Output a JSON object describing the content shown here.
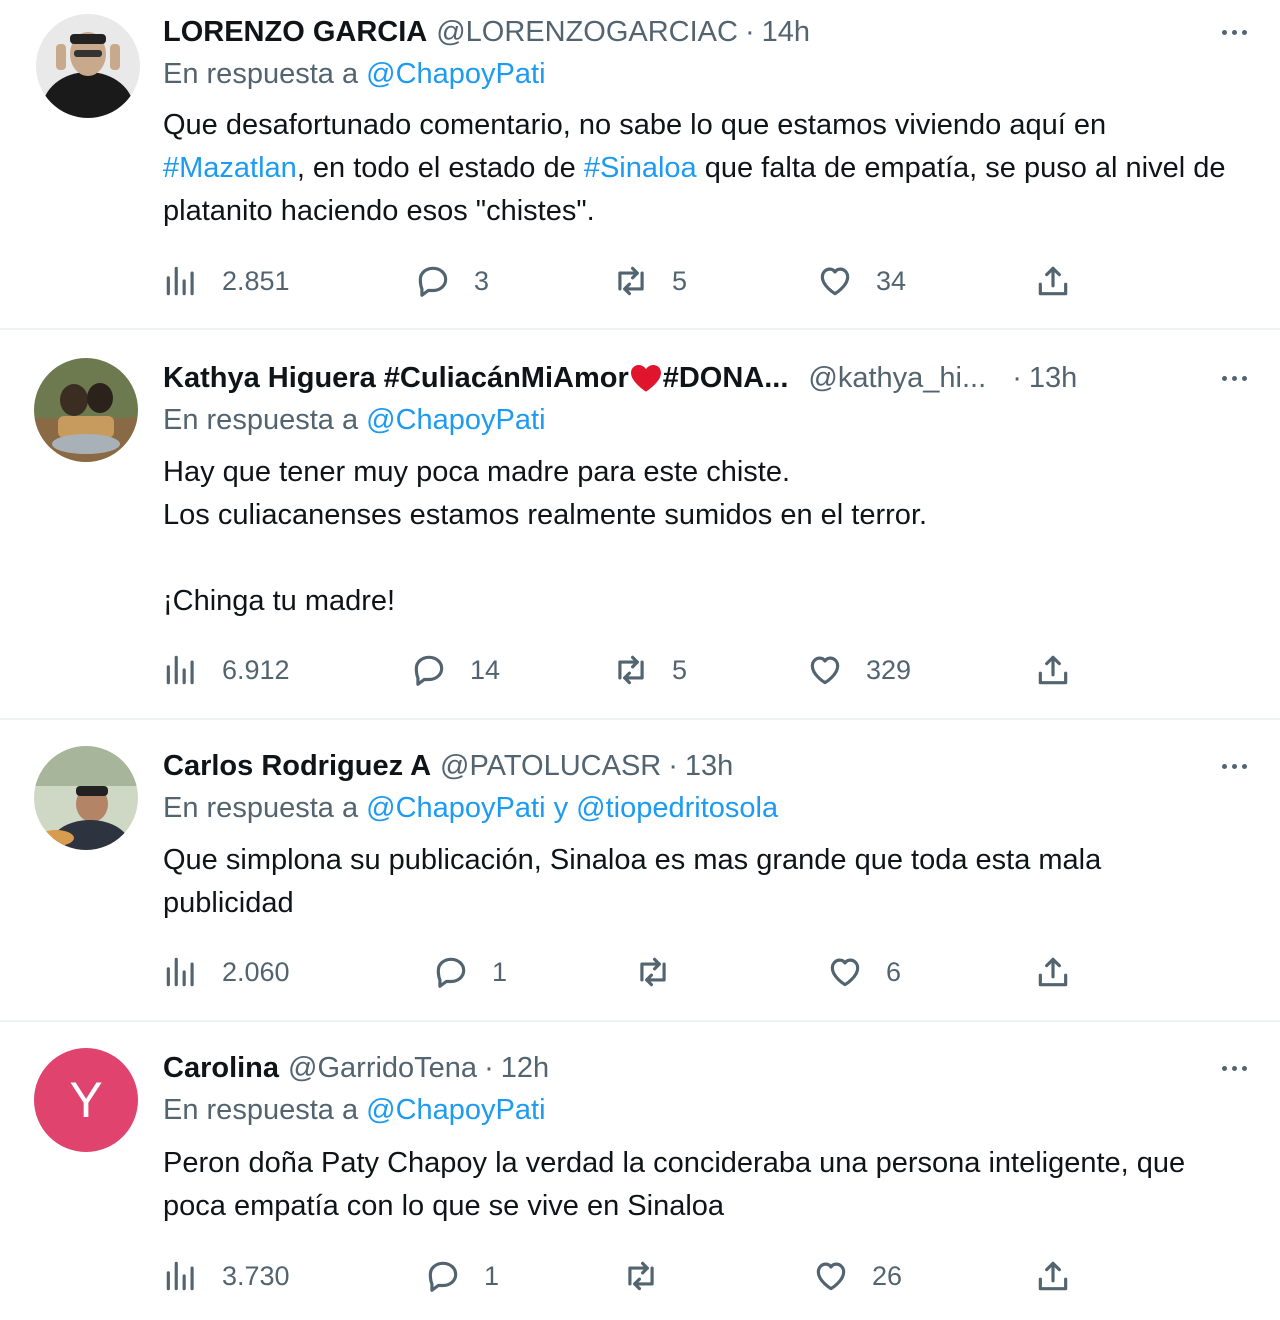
{
  "reply_prefix": "En respuesta a",
  "tweets": [
    {
      "name": "LORENZO GARCIA",
      "handle": "@LORENZOGARCIAC",
      "dot": "·",
      "time": "14h",
      "reply_to": "@ChapoyPati",
      "body_segments": [
        {
          "text": "Que desafortunado comentario, no sabe lo que estamos viviendo aquí en ",
          "type": "text"
        },
        {
          "text": "#Mazatlan",
          "type": "hashtag"
        },
        {
          "text": ", en todo el estado de ",
          "type": "text"
        },
        {
          "text": "#Sinaloa",
          "type": "hashtag"
        },
        {
          "text": " que falta de empatía, se puso al nivel de platanito haciendo esos \"chistes\".",
          "type": "text"
        }
      ],
      "views": "2.851",
      "replies": "3",
      "retweets": "5",
      "likes": "34"
    },
    {
      "name": "Kathya Higuera #CuliacánMiAmor",
      "name_suffix": "#DONA...",
      "name_emoji": "red-heart",
      "handle": "@kathya_hi...",
      "dot": "·",
      "time": "13h",
      "reply_to": "@ChapoyPati",
      "body_lines": [
        "Hay que tener muy poca madre para este chiste.",
        "Los culiacanenses estamos realmente sumidos en el terror.",
        "",
        "¡Chinga tu madre!"
      ],
      "views": "6.912",
      "replies": "14",
      "retweets": "5",
      "likes": "329"
    },
    {
      "name": "Carlos Rodriguez A",
      "handle": "@PATOLUCASR",
      "dot": "·",
      "time": "13h",
      "reply_to": "@ChapoyPati",
      "reply_joiner": "y",
      "reply_to_2": "@tiopedritosola",
      "body": "Que simplona su publicación, Sinaloa es mas grande que toda esta mala publicidad",
      "views": "2.060",
      "replies": "1",
      "retweets": "",
      "likes": "6"
    },
    {
      "name": "Carolina",
      "handle": "@GarridoTena",
      "dot": "·",
      "time": "12h",
      "avatar_letter": "Y",
      "avatar_color": "#e0446e",
      "reply_to": "@ChapoyPati",
      "body": "Peron doña Paty Chapoy la verdad la concideraba una persona inteligente, que poca empatía con lo que se vive en Sinaloa",
      "views": "3.730",
      "replies": "1",
      "retweets": "",
      "likes": "26"
    }
  ],
  "colors": {
    "text": "#0f1419",
    "secondary": "#536471",
    "link": "#1d9bf0",
    "divider": "#eff3f4"
  }
}
